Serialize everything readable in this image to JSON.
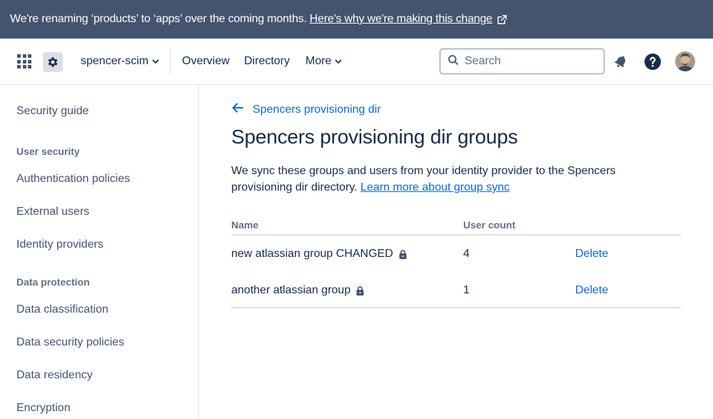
{
  "banner": {
    "text": "We're renaming ‘products’ to ‘apps’ over the coming months.",
    "link": "Here's why we're making this change",
    "link_icon": "external-link-icon"
  },
  "topnav": {
    "app_switcher_icon": "app-switcher-icon",
    "settings_icon": "gear-icon",
    "org_name": "spencer-scim",
    "links": [
      "Overview",
      "Directory",
      "More"
    ],
    "search_placeholder": "Search",
    "notifications_icon": "notification-bell-icon",
    "help_icon": "help-icon",
    "avatar_icon": "user-avatar"
  },
  "sidebar": {
    "items": [
      {
        "type": "link",
        "label": "Security guide"
      },
      {
        "type": "heading",
        "label": "User security"
      },
      {
        "type": "link",
        "label": "Authentication policies"
      },
      {
        "type": "link",
        "label": "External users"
      },
      {
        "type": "link",
        "label": "Identity providers"
      },
      {
        "type": "heading",
        "label": "Data protection"
      },
      {
        "type": "link",
        "label": "Data classification"
      },
      {
        "type": "link",
        "label": "Data security policies"
      },
      {
        "type": "link",
        "label": "Data residency"
      },
      {
        "type": "link",
        "label": "Encryption"
      }
    ]
  },
  "main": {
    "back_label": "Spencers provisioning dir",
    "title": "Spencers provisioning dir groups",
    "description": "We sync these groups and users from your identity provider to the Spencers provisioning dir directory.",
    "learn_more": "Learn more about group sync",
    "table": {
      "columns": [
        "Name",
        "User count",
        ""
      ],
      "rows": [
        {
          "name": "new atlassian group CHANGED",
          "user_count": "4",
          "action": "Delete"
        },
        {
          "name": "another atlassian group",
          "user_count": "1",
          "action": "Delete"
        }
      ]
    }
  },
  "colors": {
    "banner_bg": "#44546F",
    "link": "#0C66E4",
    "text": "#172B4D",
    "subtle_text": "#44546F"
  }
}
